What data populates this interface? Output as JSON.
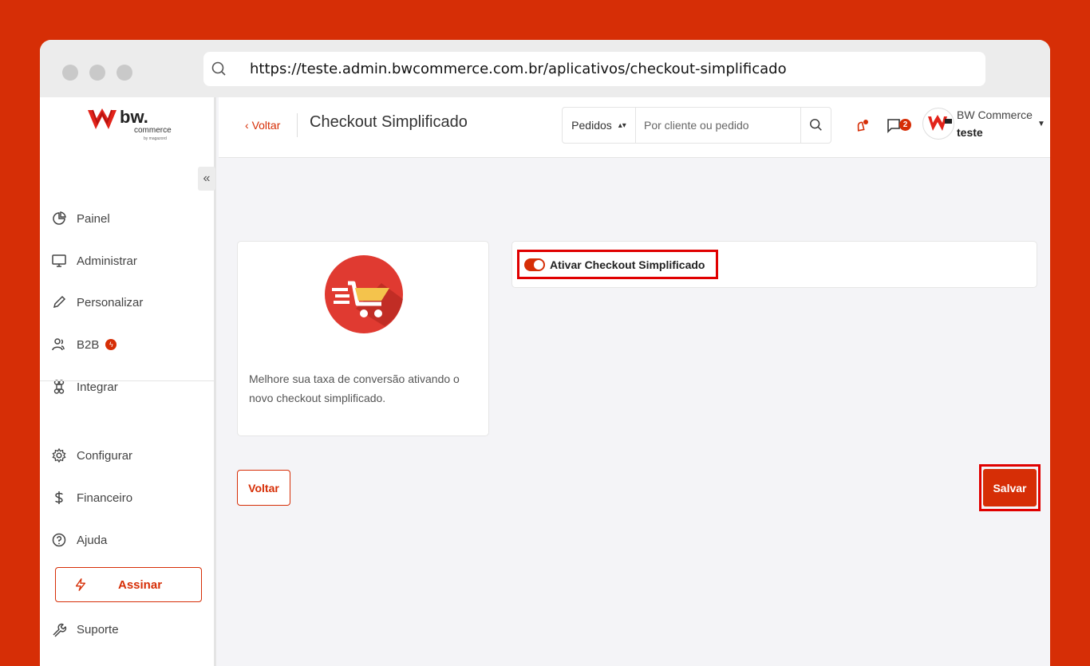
{
  "browser": {
    "url": "https://teste.admin.bwcommerce.com.br/aplicativos/checkout-simplificado"
  },
  "sidebar": {
    "logo": {
      "main": "bw.",
      "sub": "commerce",
      "byline": "by magazord"
    },
    "items": [
      {
        "label": "Painel",
        "icon": "pie-chart-icon"
      },
      {
        "label": "Administrar",
        "icon": "monitor-icon"
      },
      {
        "label": "Personalizar",
        "icon": "pencil-icon"
      },
      {
        "label": "B2B",
        "icon": "users-icon"
      },
      {
        "label": "Integrar",
        "icon": "command-icon"
      },
      {
        "label": "Configurar",
        "icon": "gear-icon"
      },
      {
        "label": "Financeiro",
        "icon": "dollar-icon"
      },
      {
        "label": "Ajuda",
        "icon": "help-circle-icon"
      },
      {
        "label": "Suporte",
        "icon": "wrench-icon"
      }
    ],
    "subscribe_label": "Assinar"
  },
  "header": {
    "back_label": "Voltar",
    "title": "Checkout Simplificado",
    "search": {
      "scope": "Pedidos",
      "placeholder": "Por cliente ou pedido"
    },
    "messages_count": "2",
    "user": {
      "name": "BW Commerce",
      "store": "teste"
    }
  },
  "main": {
    "description": "Melhore sua taxa de conversão ativando o novo checkout simplificado.",
    "toggle_label": "Ativar Checkout Simplificado",
    "toggle_on": true,
    "back_button": "Voltar",
    "save_button": "Salvar"
  },
  "colors": {
    "accent": "#d62e06",
    "highlight": "#e00000",
    "cart_circle": "#e03a31",
    "cart_basket": "#f4c34c"
  }
}
